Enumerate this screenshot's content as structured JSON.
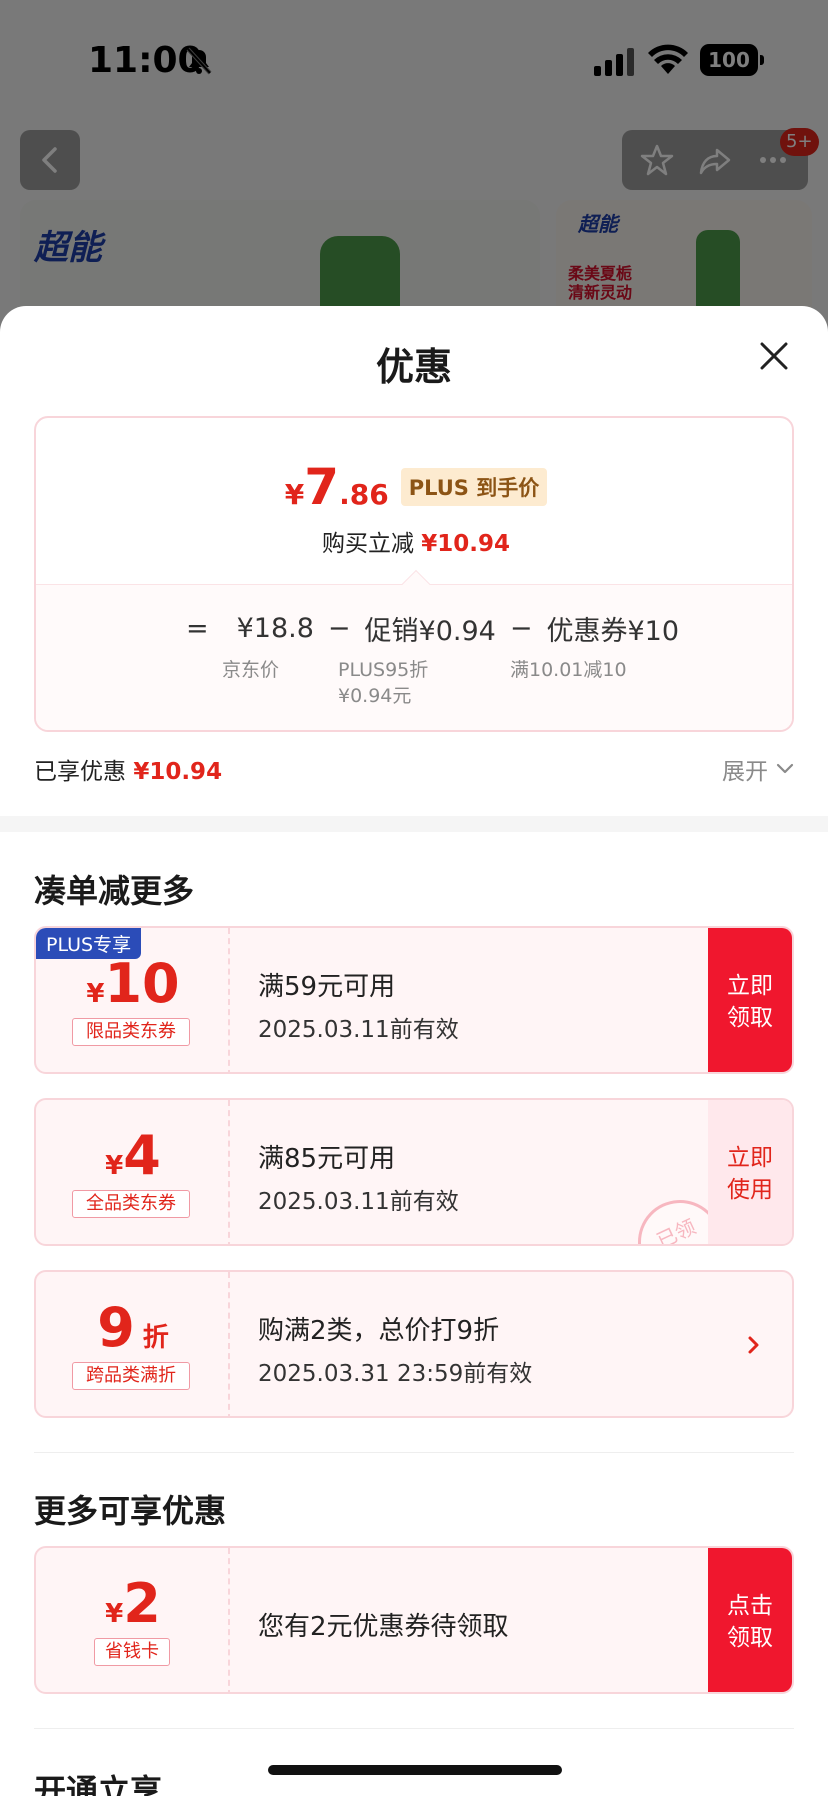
{
  "status_bar": {
    "time": "11:00",
    "battery": "100"
  },
  "background": {
    "cart_badge": "5+",
    "brand_logo": "超能",
    "brand_logo_small": "超能",
    "promo_text": "柔美夏栀 清新灵动"
  },
  "sheet": {
    "title": "优惠",
    "price": {
      "currency": "¥",
      "integer": "7",
      "decimal": ".86",
      "plus_tag": "PLUS 到手价",
      "instant_label": "购买立减",
      "instant_amount": "¥10.94"
    },
    "formula": {
      "equals": "=",
      "jd_price": "¥18.8",
      "minus1": "−",
      "promo": "促销¥0.94",
      "minus2": "−",
      "coupon": "优惠券¥10",
      "jd_price_label": "京东价",
      "promo_label_1": "PLUS95折",
      "promo_label_2": "¥0.94元",
      "coupon_label": "满10.01减10"
    },
    "enjoyed_label": "已享优惠",
    "enjoyed_amount": "¥10.94",
    "expand_label": "展开",
    "section_more": "凑单减更多",
    "coupons": [
      {
        "corner": "PLUS专享",
        "yen": "¥",
        "amount": "10",
        "type": "限品类东券",
        "condition": "满59元可用",
        "date": "2025.03.11前有效",
        "cta": "立即领取"
      },
      {
        "yen": "¥",
        "amount": "4",
        "type": "全品类东券",
        "condition": "满85元可用",
        "date": "2025.03.11前有效",
        "cta": "立即使用",
        "stamp": "已领"
      },
      {
        "amount": "9",
        "unit": "折",
        "type": "跨品类满折",
        "condition": "购满2类，总价打9折",
        "date": "2025.03.31 23:59前有效"
      }
    ],
    "section_extra": "更多可享优惠",
    "extra_coupon": {
      "yen": "¥",
      "amount": "2",
      "type": "省钱卡",
      "condition": "您有2元优惠券待领取",
      "cta": "点击领取"
    },
    "section_open": "开通立享"
  },
  "colors": {
    "accent": "#e1251b",
    "plus_blue": "#2b4cb8",
    "plus_gold": "#8c5415"
  }
}
